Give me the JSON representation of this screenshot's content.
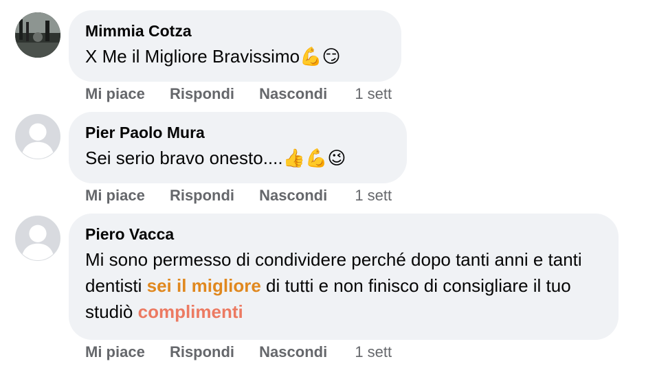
{
  "comments": [
    {
      "author": "Mimmia Cotza",
      "text_segments": [
        {
          "t": "X Me il Migliore Bravissimo",
          "style": "normal"
        },
        {
          "t": "💪😏",
          "style": "emoji"
        }
      ],
      "actions": {
        "like": "Mi piace",
        "reply": "Rispondi",
        "hide": "Nascondi"
      },
      "time": "1 sett",
      "avatar": "photo-avatar"
    },
    {
      "author": "Pier Paolo Mura",
      "text_segments": [
        {
          "t": "Sei serio bravo onesto....",
          "style": "normal"
        },
        {
          "t": "👍💪😉",
          "style": "emoji"
        }
      ],
      "actions": {
        "like": "Mi piace",
        "reply": "Rispondi",
        "hide": "Nascondi"
      },
      "time": "1 sett",
      "avatar": "default-avatar"
    },
    {
      "author": "Piero Vacca",
      "text_segments": [
        {
          "t": "Mi sono permesso di condividere perché dopo tanti anni e tanti dentisti ",
          "style": "normal"
        },
        {
          "t": "sei il migliore",
          "style": "highlight-orange"
        },
        {
          "t": " di tutti e non finisco di consigliare il tuo studiò ",
          "style": "normal"
        },
        {
          "t": "complimenti",
          "style": "highlight-salmon"
        }
      ],
      "actions": {
        "like": "Mi piace",
        "reply": "Rispondi",
        "hide": "Nascondi"
      },
      "time": "1 sett",
      "avatar": "default-avatar"
    }
  ],
  "colors": {
    "bubble": "#f0f2f5",
    "meta_text": "#65676b",
    "highlight_orange": "#e0881f",
    "highlight_salmon": "#ec7a62"
  }
}
